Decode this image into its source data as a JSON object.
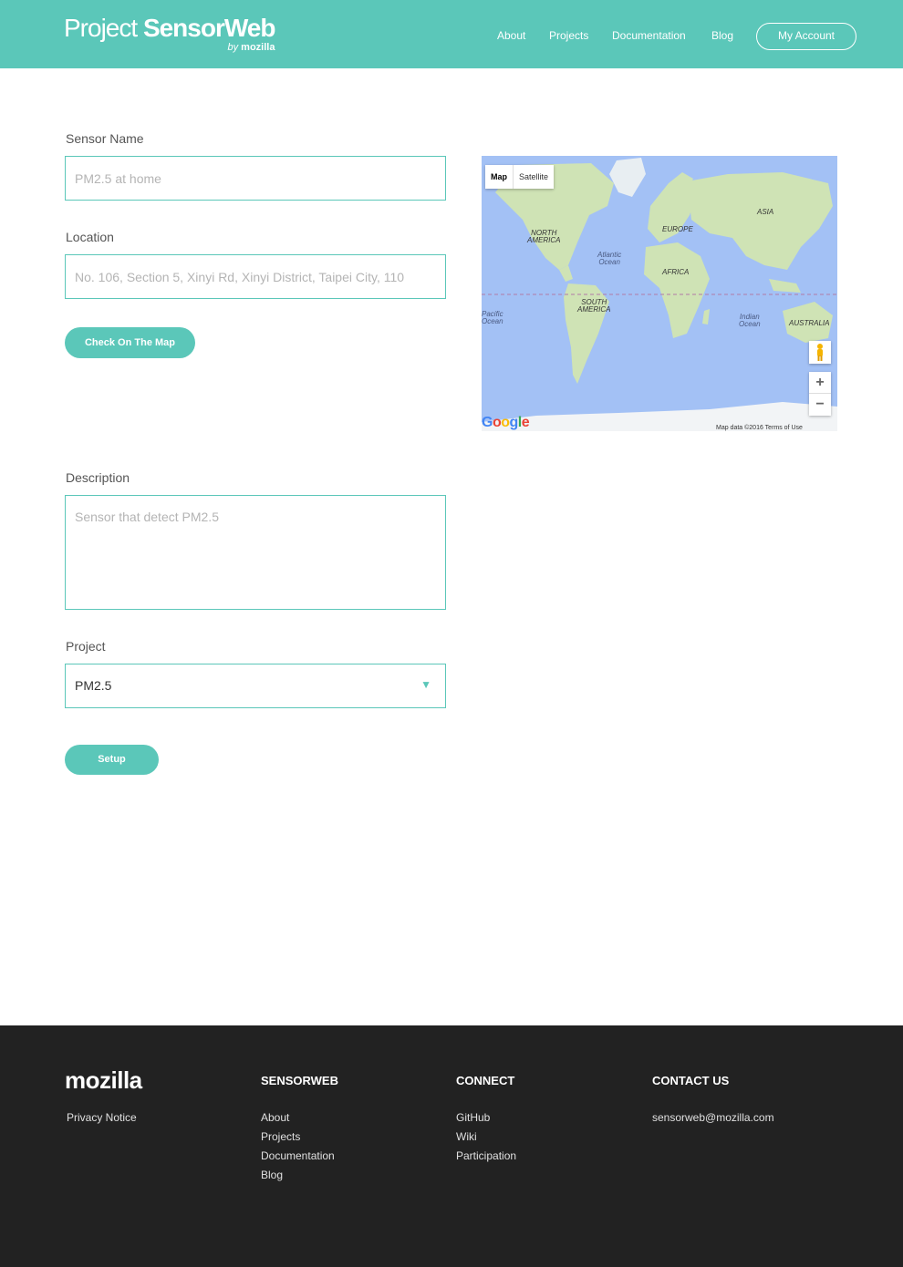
{
  "header": {
    "logo_light": "Project ",
    "logo_bold": "SensorWeb",
    "logo_by": "by",
    "logo_brand": "mozilla",
    "nav": [
      "About",
      "Projects",
      "Documentation",
      "Blog"
    ],
    "account_label": "My Account"
  },
  "form": {
    "sensor_name_label": "Sensor Name",
    "sensor_name_placeholder": "PM2.5 at home",
    "location_label": "Location",
    "location_placeholder": "No. 106, Section 5, Xinyi Rd, Xinyi District, Taipei City, 110",
    "check_map_label": "Check On The Map",
    "description_label": "Description",
    "description_placeholder": "Sensor that detect PM2.5",
    "project_label": "Project",
    "project_value": "PM2.5",
    "setup_label": "Setup"
  },
  "map": {
    "type_map": "Map",
    "type_satellite": "Satellite",
    "labels": {
      "north_america": "NORTH\nAMERICA",
      "south_america": "SOUTH\nAMERICA",
      "europe": "EUROPE",
      "asia": "ASIA",
      "africa": "AFRICA",
      "australia": "AUSTRALIA",
      "atlantic": "Atlantic\nOcean",
      "pacific": "Pacific\nOcean",
      "indian": "Indian\nOcean"
    },
    "zoom_in": "+",
    "zoom_out": "−",
    "google": "Google",
    "attribution": "Map data ©2016   Terms of Use"
  },
  "footer": {
    "logo": "mozilla",
    "privacy": "Privacy Notice",
    "sensorweb_head": "SENSORWEB",
    "sensorweb_links": [
      "About",
      "Projects",
      "Documentation",
      "Blog"
    ],
    "connect_head": "CONNECT",
    "connect_links": [
      "GitHub",
      "Wiki",
      "Participation"
    ],
    "contact_head": "CONTACT US",
    "contact_email": "sensorweb@mozilla.com"
  },
  "colors": {
    "accent": "#5bc7b9",
    "footer_bg": "#222222",
    "ocean": "#a3c1f5",
    "land": "#cfe3b5"
  }
}
